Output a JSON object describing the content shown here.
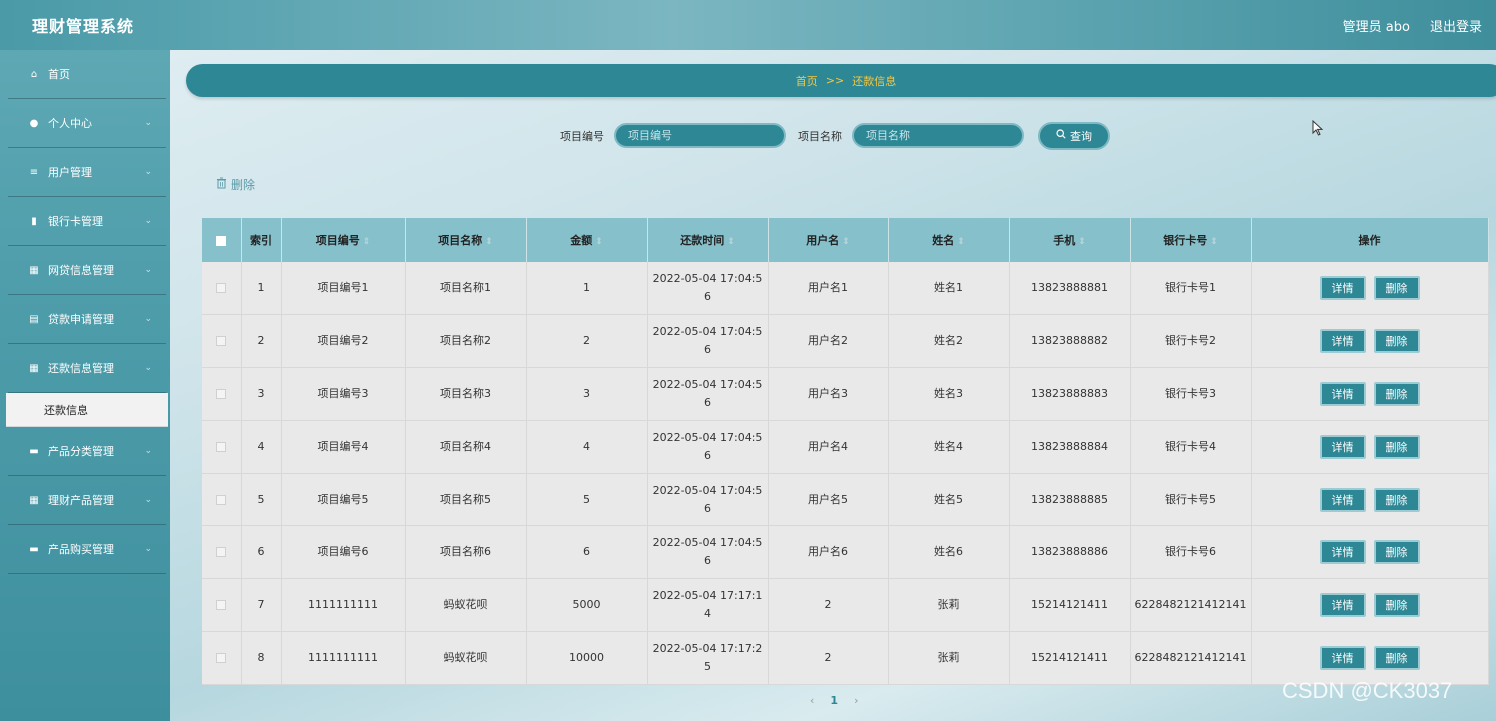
{
  "header": {
    "title": "理财管理系统",
    "user": "管理员 abo",
    "logout": "退出登录"
  },
  "sidebar": {
    "items": [
      {
        "label": "首页",
        "icon": "home-icon",
        "glyph": "⌂"
      },
      {
        "label": "个人中心",
        "icon": "user-icon",
        "glyph": "●"
      },
      {
        "label": "用户管理",
        "icon": "list-icon",
        "glyph": "≡"
      },
      {
        "label": "银行卡管理",
        "icon": "bars-icon",
        "glyph": "▮"
      },
      {
        "label": "网贷信息管理",
        "icon": "grid-icon",
        "glyph": "▦"
      },
      {
        "label": "贷款申请管理",
        "icon": "clipboard-icon",
        "glyph": "▤"
      },
      {
        "label": "还款信息管理",
        "icon": "grid-icon",
        "glyph": "▦"
      },
      {
        "label": "产品分类管理",
        "icon": "monitor-icon",
        "glyph": "▬"
      },
      {
        "label": "理财产品管理",
        "icon": "grid-icon",
        "glyph": "▦"
      },
      {
        "label": "产品购买管理",
        "icon": "monitor-icon",
        "glyph": "▬"
      }
    ],
    "sub_item": "还款信息"
  },
  "breadcrumb": {
    "home": "首页",
    "separator": ">>",
    "current": "还款信息"
  },
  "search": {
    "field1_label": "项目编号",
    "field1_placeholder": "项目编号",
    "field2_label": "项目名称",
    "field2_placeholder": "项目名称",
    "button_label": "查询"
  },
  "toolbar": {
    "delete_label": "删除"
  },
  "table": {
    "columns": [
      "索引",
      "项目编号",
      "项目名称",
      "金额",
      "还款时间",
      "用户名",
      "姓名",
      "手机",
      "银行卡号",
      "操作"
    ],
    "rows": [
      {
        "index": "1",
        "code": "项目编号1",
        "name": "项目名称1",
        "amount": "1",
        "time": "2022-05-04 17:04:56",
        "username": "用户名1",
        "realname": "姓名1",
        "phone": "13823888881",
        "card": "银行卡号1"
      },
      {
        "index": "2",
        "code": "项目编号2",
        "name": "项目名称2",
        "amount": "2",
        "time": "2022-05-04 17:04:56",
        "username": "用户名2",
        "realname": "姓名2",
        "phone": "13823888882",
        "card": "银行卡号2"
      },
      {
        "index": "3",
        "code": "项目编号3",
        "name": "项目名称3",
        "amount": "3",
        "time": "2022-05-04 17:04:56",
        "username": "用户名3",
        "realname": "姓名3",
        "phone": "13823888883",
        "card": "银行卡号3"
      },
      {
        "index": "4",
        "code": "项目编号4",
        "name": "项目名称4",
        "amount": "4",
        "time": "2022-05-04 17:04:56",
        "username": "用户名4",
        "realname": "姓名4",
        "phone": "13823888884",
        "card": "银行卡号4"
      },
      {
        "index": "5",
        "code": "项目编号5",
        "name": "项目名称5",
        "amount": "5",
        "time": "2022-05-04 17:04:56",
        "username": "用户名5",
        "realname": "姓名5",
        "phone": "13823888885",
        "card": "银行卡号5"
      },
      {
        "index": "6",
        "code": "项目编号6",
        "name": "项目名称6",
        "amount": "6",
        "time": "2022-05-04 17:04:56",
        "username": "用户名6",
        "realname": "姓名6",
        "phone": "13823888886",
        "card": "银行卡号6"
      },
      {
        "index": "7",
        "code": "1111111111",
        "name": "蚂蚁花呗",
        "amount": "5000",
        "time": "2022-05-04 17:17:14",
        "username": "2",
        "realname": "张莉",
        "phone": "15214121411",
        "card": "6228482121412141"
      },
      {
        "index": "8",
        "code": "1111111111",
        "name": "蚂蚁花呗",
        "amount": "10000",
        "time": "2022-05-04 17:17:25",
        "username": "2",
        "realname": "张莉",
        "phone": "15214121411",
        "card": "6228482121412141"
      }
    ],
    "detail_label": "详情",
    "delete_label": "删除"
  },
  "pagination": {
    "prev": "‹",
    "current": "1",
    "next": "›"
  },
  "watermark": "CSDN @CK3037",
  "colors": {
    "primary": "#2d8795",
    "header_bg": "#86c0cb",
    "breadcrumb_text": "#f5c842"
  }
}
